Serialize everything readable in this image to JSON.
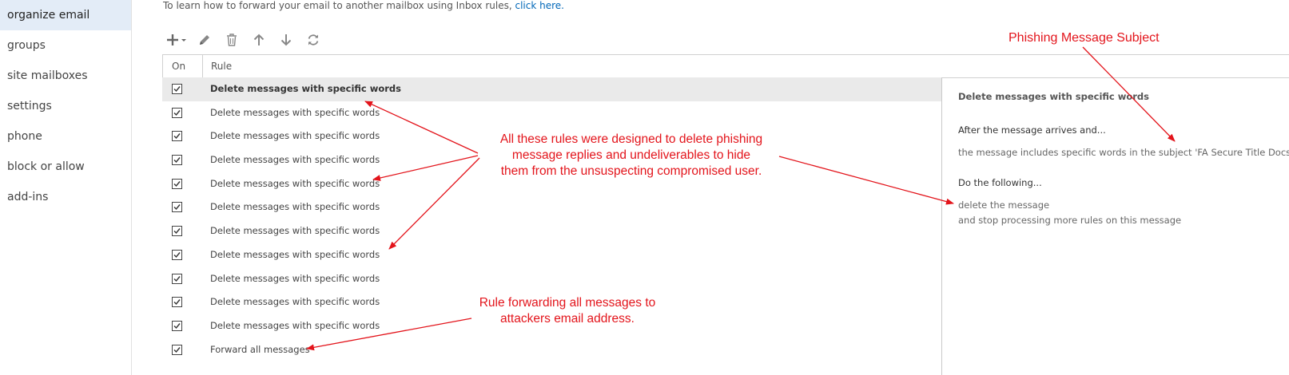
{
  "nav": {
    "items": [
      "organize email",
      "groups",
      "site mailboxes",
      "settings",
      "phone",
      "block or allow",
      "add-ins"
    ]
  },
  "intro": {
    "text": "To learn how to forward your email to another mailbox using Inbox rules,",
    "link": "click here."
  },
  "toolbar": {
    "icons": [
      "add-dropdown-icon",
      "edit-pencil-icon",
      "delete-trash-icon",
      "move-up-arrow-icon",
      "move-down-arrow-icon",
      "refresh-icon"
    ]
  },
  "grid": {
    "col_on": "On",
    "col_rule": "Rule",
    "rows": [
      {
        "on": true,
        "name": "Delete messages with specific words"
      },
      {
        "on": true,
        "name": "Delete messages with specific words"
      },
      {
        "on": true,
        "name": "Delete messages with specific words"
      },
      {
        "on": true,
        "name": "Delete messages with specific words"
      },
      {
        "on": true,
        "name": "Delete messages with specific words"
      },
      {
        "on": true,
        "name": "Delete messages with specific words"
      },
      {
        "on": true,
        "name": "Delete messages with specific words"
      },
      {
        "on": true,
        "name": "Delete messages with specific words"
      },
      {
        "on": true,
        "name": "Delete messages with specific words"
      },
      {
        "on": true,
        "name": "Delete messages with specific words"
      },
      {
        "on": true,
        "name": "Delete messages with specific words"
      },
      {
        "on": true,
        "name": "Forward all messages"
      }
    ]
  },
  "detail": {
    "title": "Delete messages with specific words",
    "condition_heading": "After the message arrives and...",
    "condition": "the message includes specific words in the subject 'FA Secure Title Docs",
    "action_heading": "Do the following...",
    "action_1": "delete the message",
    "action_2": "and stop processing more rules on this message"
  },
  "annotations": {
    "subject_label": "Phishing Message Subject",
    "rules_line_1": "All these rules were designed to delete phishing",
    "rules_line_2": "message replies and undeliverables to hide",
    "rules_line_3": "them from the unsuspecting compromised user.",
    "forward_line_1": "Rule forwarding all messages to",
    "forward_line_2": "attackers email address.",
    "color": "#e3141b"
  }
}
